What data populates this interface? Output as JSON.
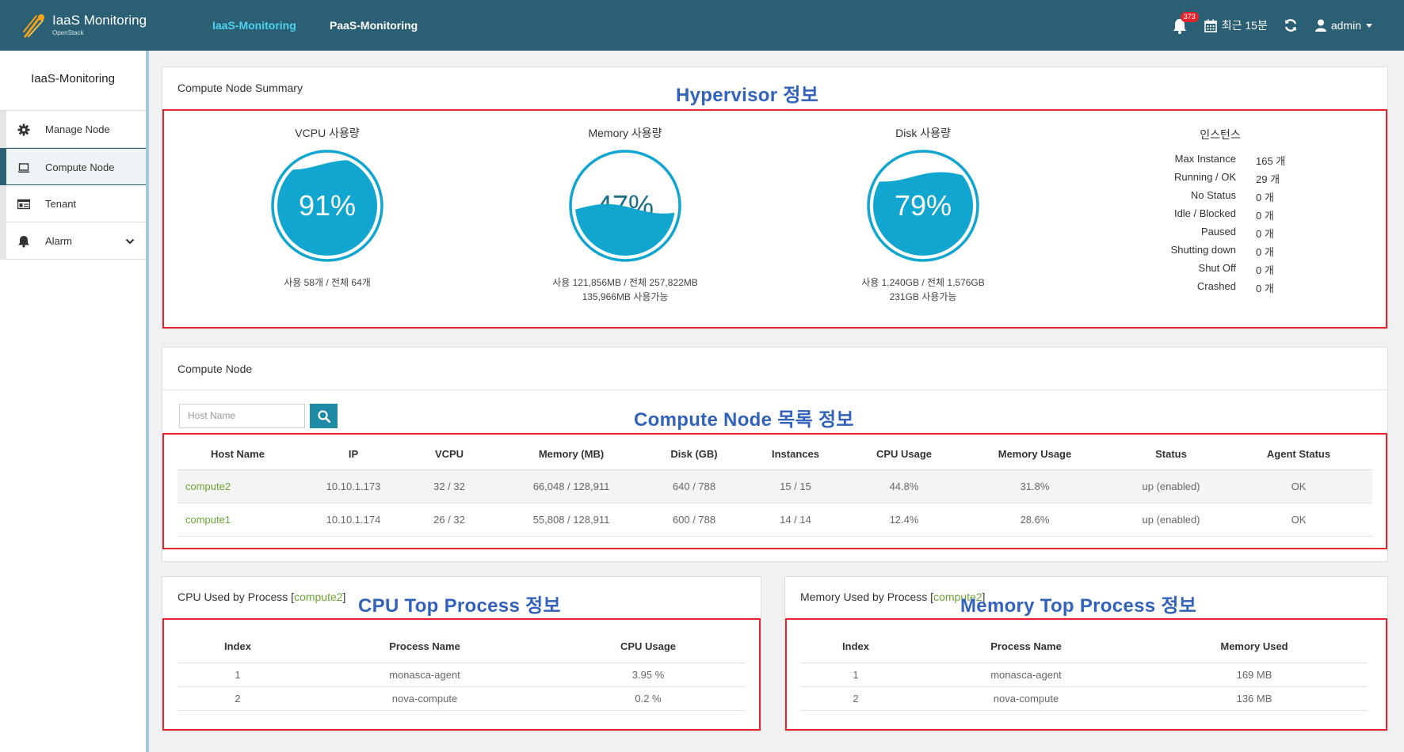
{
  "header": {
    "app_title": "IaaS Monitoring",
    "app_subtitle": "OpenStack",
    "nav": [
      {
        "label": "IaaS-Monitoring",
        "active": true
      },
      {
        "label": "PaaS-Monitoring",
        "active": false
      }
    ],
    "alarm_count": "373",
    "time_range": "최근 15분",
    "user": "admin"
  },
  "sidebar": {
    "title": "IaaS-Monitoring",
    "items": [
      {
        "label": "Manage Node",
        "icon": "gear-icon"
      },
      {
        "label": "Compute Node",
        "icon": "laptop-icon",
        "active": true
      },
      {
        "label": "Tenant",
        "icon": "id-card-icon"
      },
      {
        "label": "Alarm",
        "icon": "bell-icon"
      }
    ]
  },
  "summary": {
    "title": "Compute Node Summary",
    "annotation": "Hypervisor 정보",
    "vcpu": {
      "label": "VCPU 사용량",
      "percent": 91,
      "percent_text": "91%",
      "detail": "사용 58개 / 전체 64개"
    },
    "memory": {
      "label": "Memory 사용량",
      "percent": 47,
      "percent_text": "47%",
      "detail": "사용 121,856MB / 전체 257,822MB",
      "available": "135,966MB 사용가능"
    },
    "disk": {
      "label": "Disk 사용량",
      "percent": 79,
      "percent_text": "79%",
      "detail": "사용 1,240GB / 전체 1,576GB",
      "available": "231GB 사용가능"
    },
    "instances": {
      "title": "인스턴스",
      "rows": [
        {
          "label": "Max Instance",
          "value": "165 개"
        },
        {
          "label": "Running / OK",
          "value": "29 개"
        },
        {
          "label": "No Status",
          "value": "0 개"
        },
        {
          "label": "Idle / Blocked",
          "value": "0 개"
        },
        {
          "label": "Paused",
          "value": "0 개"
        },
        {
          "label": "Shutting down",
          "value": "0 개"
        },
        {
          "label": "Shut Off",
          "value": "0 개"
        },
        {
          "label": "Crashed",
          "value": "0 개"
        }
      ]
    }
  },
  "nodes": {
    "title": "Compute Node",
    "annotation": "Compute Node 목록 정보",
    "search_placeholder": "Host Name",
    "columns": [
      "Host Name",
      "IP",
      "VCPU",
      "Memory (MB)",
      "Disk (GB)",
      "Instances",
      "CPU Usage",
      "Memory Usage",
      "Status",
      "Agent Status"
    ],
    "rows": [
      [
        "compute2",
        "10.10.1.173",
        "32 / 32",
        "66,048 / 128,911",
        "640 / 788",
        "15 / 15",
        "44.8%",
        "31.8%",
        "up (enabled)",
        "OK"
      ],
      [
        "compute1",
        "10.10.1.174",
        "26 / 32",
        "55,808 / 128,911",
        "600 / 788",
        "14 / 14",
        "12.4%",
        "28.6%",
        "up (enabled)",
        "OK"
      ]
    ]
  },
  "cpu_process": {
    "title": "CPU Used by Process",
    "bracket_open": "[",
    "host": "compute2",
    "bracket_close": "]",
    "annotation": "CPU Top Process 정보",
    "columns": [
      "Index",
      "Process Name",
      "CPU Usage"
    ],
    "rows": [
      [
        "1",
        "monasca-agent",
        "3.95 %"
      ],
      [
        "2",
        "nova-compute",
        "0.2 %"
      ]
    ]
  },
  "mem_process": {
    "title": "Memory Used by Process",
    "bracket_open": "[",
    "host": "compute2",
    "bracket_close": "]",
    "annotation": "Memory Top Process 정보",
    "columns": [
      "Index",
      "Process Name",
      "Memory Used"
    ],
    "rows": [
      [
        "1",
        "monasca-agent",
        "169 MB"
      ],
      [
        "2",
        "nova-compute",
        "136 MB"
      ]
    ]
  },
  "colors": {
    "header_bg": "#2b5f73",
    "active_nav": "#4fd2f0",
    "gauge": "#11a6cf",
    "annotation": "#3262b9",
    "highlight_box": "#e3262e",
    "host_link": "#6aa532"
  }
}
